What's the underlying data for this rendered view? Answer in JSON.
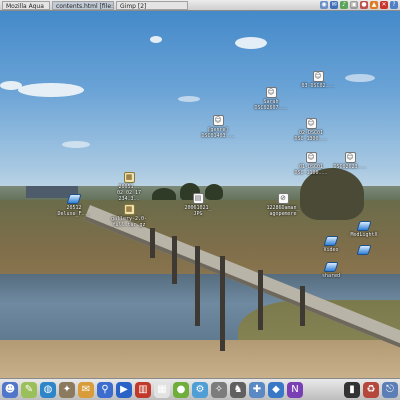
{
  "top_panel": {
    "tasks": [
      {
        "label": "Mozilla Aqua",
        "active": false
      },
      {
        "label": "contents.html [file:/",
        "active": true
      },
      {
        "label": "Gimp [2]",
        "active": false
      }
    ],
    "tray_icons": [
      {
        "name": "network-icon",
        "color": "#6a8fc7",
        "glyph": "◉"
      },
      {
        "name": "mail-icon",
        "color": "#3e6fb8",
        "glyph": "✉"
      },
      {
        "name": "volume-icon",
        "color": "#5aa35a",
        "glyph": "♪"
      },
      {
        "name": "monitor-icon",
        "color": "#9b9b9b",
        "glyph": "▣"
      },
      {
        "name": "user-icon",
        "color": "#c0504d",
        "glyph": "●"
      },
      {
        "name": "warning-icon",
        "color": "#e07b25",
        "glyph": "▲"
      },
      {
        "name": "exit-icon",
        "color": "#c8332b",
        "glyph": "✕"
      },
      {
        "name": "help-icon",
        "color": "#4e7fc4",
        "glyph": "?"
      }
    ]
  },
  "desktop_icons": [
    {
      "name": "desktop-icon-sarah",
      "glyph": "☺",
      "style": "doc",
      "label": "Sarah\nDSC02607..."
    },
    {
      "name": "desktop-icon-03",
      "glyph": "☺",
      "style": "doc",
      "label": "03-DSC02..."
    },
    {
      "name": "desktop-icon-genre",
      "glyph": "☺",
      "style": "doc",
      "label": "[genre]\nDSC01403..."
    },
    {
      "name": "desktop-icon-02",
      "glyph": "☺",
      "style": "doc",
      "label": "02-DSC01\nDSC-1300..."
    },
    {
      "name": "desktop-icon-01",
      "glyph": "☺",
      "style": "doc",
      "label": "01-DSC01\nDSC-1100..."
    },
    {
      "name": "desktop-icon-new-jpg",
      "glyph": "☺",
      "style": "doc",
      "label": "DSC02623..."
    },
    {
      "name": "desktop-icon-20051",
      "glyph": "▦",
      "style": "tar",
      "label": "20051..\n02_02_17\n234.3.."
    },
    {
      "name": "desktop-icon-20061021",
      "glyph": "▤",
      "style": "doc",
      "label": "20061021_\nJPG"
    },
    {
      "name": "desktop-icon-12286",
      "glyph": "⊘",
      "style": "doc",
      "label": "12286Daman_\nagopemore"
    },
    {
      "name": "desktop-icon-20512-deluxe",
      "glyph": "",
      "style": "blue",
      "label": "20512\nDeluxe_F..."
    },
    {
      "name": "desktop-icon-gallery-tarball",
      "glyph": "▦",
      "style": "tar",
      "label": "gallery-2.0-\nfull.tar.gz"
    },
    {
      "name": "desktop-icon-mod",
      "glyph": "",
      "style": "blue",
      "label": "ModLightX"
    },
    {
      "name": "desktop-icon-video",
      "glyph": "",
      "style": "blue",
      "label": "Video"
    },
    {
      "name": "desktop-icon-blue-2",
      "glyph": "",
      "style": "blue",
      "label": ""
    },
    {
      "name": "desktop-icon-shared",
      "glyph": "",
      "style": "blue",
      "label": "shared"
    }
  ],
  "dock": {
    "left": [
      {
        "name": "finder-icon",
        "color": "#5077c9",
        "glyph": "☻"
      },
      {
        "name": "text-editor-icon",
        "color": "#9bbf5a",
        "glyph": "✎"
      },
      {
        "name": "globe-icon",
        "color": "#2e86c9",
        "glyph": "◍"
      },
      {
        "name": "gimp-icon",
        "color": "#8c7a5f",
        "glyph": "✦"
      },
      {
        "name": "mail-client-icon",
        "color": "#d89c3a",
        "glyph": "✉"
      },
      {
        "name": "utility-icon",
        "color": "#3d6ccf",
        "glyph": "⚲"
      },
      {
        "name": "media-player-icon",
        "color": "#2a62c8",
        "glyph": "▶"
      },
      {
        "name": "library-icon",
        "color": "#c0392b",
        "glyph": "▥"
      },
      {
        "name": "calendar-icon",
        "color": "#e2e2e2",
        "glyph": "▦"
      },
      {
        "name": "orb-icon",
        "color": "#6fae3a",
        "glyph": "●"
      },
      {
        "name": "gear-icon",
        "color": "#4f9fd6",
        "glyph": "⚙"
      },
      {
        "name": "compass-icon",
        "color": "#7c7c7c",
        "glyph": "✧"
      },
      {
        "name": "animal-icon",
        "color": "#606060",
        "glyph": "♞"
      },
      {
        "name": "tools-icon",
        "color": "#5a89c4",
        "glyph": "✚"
      },
      {
        "name": "network-utility-icon",
        "color": "#3978c6",
        "glyph": "◆"
      },
      {
        "name": "badge-icon",
        "color": "#7a3fb4",
        "glyph": "N"
      }
    ],
    "right": [
      {
        "name": "terminal-icon",
        "color": "#333333",
        "glyph": "▮"
      },
      {
        "name": "trash-full-icon",
        "color": "#b5473c",
        "glyph": "♻"
      },
      {
        "name": "logout-icon",
        "color": "#5b7eb6",
        "glyph": "⎋"
      }
    ]
  }
}
